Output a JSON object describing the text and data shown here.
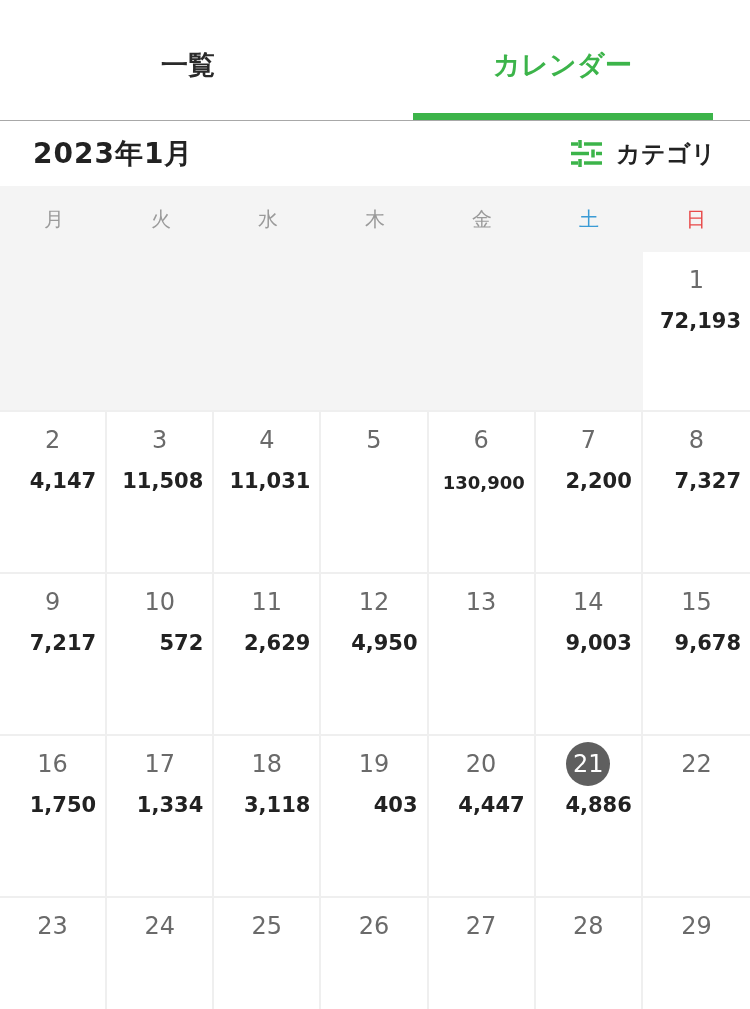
{
  "tabs": [
    {
      "label": "一覧",
      "selected": false
    },
    {
      "label": "カレンダー",
      "selected": true
    }
  ],
  "header": {
    "month": "2023年1月",
    "category_button": {
      "label": "カテゴリ"
    }
  },
  "weekdays": [
    {
      "label": "月",
      "color": "#9a9a9a"
    },
    {
      "label": "火",
      "color": "#9a9a9a"
    },
    {
      "label": "水",
      "color": "#9a9a9a"
    },
    {
      "label": "木",
      "color": "#9a9a9a"
    },
    {
      "label": "金",
      "color": "#9a9a9a"
    },
    {
      "label": "土",
      "color": "#3a9bd5"
    },
    {
      "label": "日",
      "color": "#e84a4a"
    }
  ],
  "weeks": [
    {
      "days": [
        {
          "day": "1",
          "amount": "72,193",
          "today": false
        }
      ]
    },
    {
      "days": [
        {
          "day": "2",
          "amount": "4,147",
          "today": false
        },
        {
          "day": "3",
          "amount": "11,508",
          "today": false
        },
        {
          "day": "4",
          "amount": "11,031",
          "today": false
        },
        {
          "day": "5",
          "today": false
        },
        {
          "day": "6",
          "amount": "130,900",
          "today": false
        },
        {
          "day": "7",
          "amount": "2,200",
          "today": false
        },
        {
          "day": "8",
          "amount": "7,327",
          "today": false
        }
      ]
    },
    {
      "days": [
        {
          "day": "9",
          "amount": "7,217",
          "today": false
        },
        {
          "day": "10",
          "amount": "572",
          "today": false
        },
        {
          "day": "11",
          "amount": "2,629",
          "today": false
        },
        {
          "day": "12",
          "amount": "4,950",
          "today": false
        },
        {
          "day": "13",
          "today": false
        },
        {
          "day": "14",
          "amount": "9,003",
          "today": false
        },
        {
          "day": "15",
          "amount": "9,678",
          "today": false
        }
      ]
    },
    {
      "days": [
        {
          "day": "16",
          "amount": "1,750",
          "today": false
        },
        {
          "day": "17",
          "amount": "1,334",
          "today": false
        },
        {
          "day": "18",
          "amount": "3,118",
          "today": false
        },
        {
          "day": "19",
          "amount": "403",
          "today": false
        },
        {
          "day": "20",
          "amount": "4,447",
          "today": false
        },
        {
          "day": "21",
          "amount": "4,886",
          "today": true
        },
        {
          "day": "22",
          "today": false
        }
      ]
    },
    {
      "days": [
        {
          "day": "23",
          "today": false
        },
        {
          "day": "24",
          "today": false
        },
        {
          "day": "25",
          "today": false
        },
        {
          "day": "26",
          "today": false
        },
        {
          "day": "27",
          "today": false
        },
        {
          "day": "28",
          "today": false
        },
        {
          "day": "29",
          "today": false
        }
      ]
    }
  ]
}
